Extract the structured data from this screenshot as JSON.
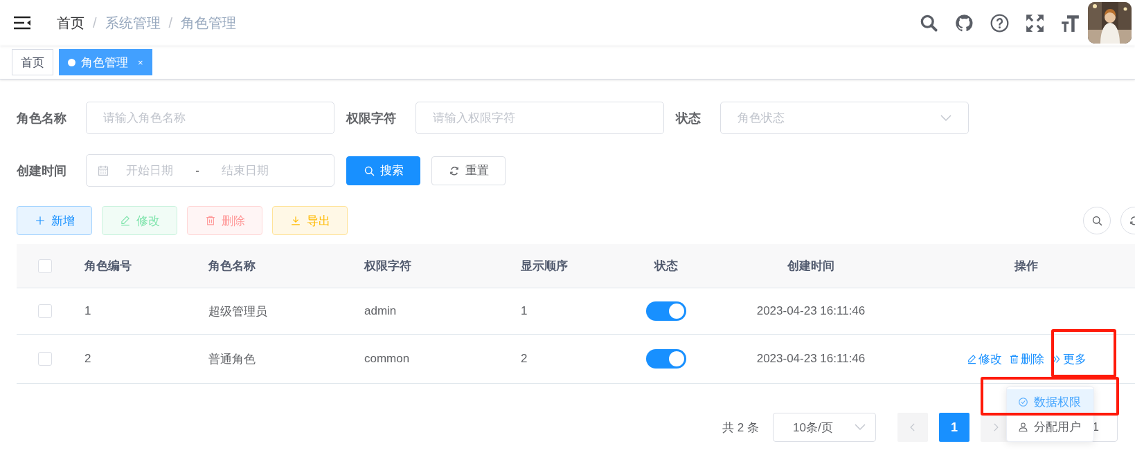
{
  "header": {
    "breadcrumb": [
      {
        "label": "首页",
        "kind": "link"
      },
      {
        "label": "系统管理",
        "kind": "text"
      },
      {
        "label": "角色管理",
        "kind": "text"
      }
    ],
    "separator": "/"
  },
  "tags": [
    {
      "label": "首页",
      "selected": false
    },
    {
      "label": "角色管理",
      "selected": true,
      "close": "×"
    }
  ],
  "search_form": {
    "fields": [
      {
        "kind": "input",
        "label": "角色名称",
        "placeholder": "请输入角色名称"
      },
      {
        "kind": "input",
        "label": "权限字符",
        "placeholder": "请输入权限字符"
      },
      {
        "kind": "select",
        "label": "状态",
        "placeholder": "角色状态"
      }
    ],
    "date_range": {
      "label": "创建时间",
      "start_placeholder": "开始日期",
      "separator": "-",
      "end_placeholder": "结束日期"
    },
    "buttons": [
      {
        "kind": "primary",
        "label": "搜索"
      },
      {
        "kind": "default",
        "label": "重置"
      }
    ]
  },
  "toolbar": [
    {
      "kind": "primary",
      "label": "新增",
      "disabled": false
    },
    {
      "kind": "success",
      "label": "修改",
      "disabled": true
    },
    {
      "kind": "danger",
      "label": "删除",
      "disabled": true
    },
    {
      "kind": "warning",
      "label": "导出",
      "disabled": false
    }
  ],
  "table": {
    "select_all_checked": false,
    "columns": [
      "角色编号",
      "角色名称",
      "权限字符",
      "显示顺序",
      "状态",
      "创建时间",
      "操作"
    ],
    "rows": [
      {
        "checked": false,
        "cells": [
          "1",
          "超级管理员",
          "admin",
          "1"
        ],
        "status_on": true,
        "created": "2023-04-23 16:11:46"
      },
      {
        "checked": false,
        "cells": [
          "2",
          "普通角色",
          "common",
          "2"
        ],
        "status_on": true,
        "created": "2023-04-23 16:11:46",
        "actions": [
          {
            "kind": "edit",
            "label": "修改"
          },
          {
            "kind": "delete",
            "label": "删除"
          },
          {
            "kind": "more",
            "label": "更多"
          }
        ]
      }
    ]
  },
  "pagination": {
    "total": "共 2 条",
    "page_size": "10条/页",
    "pages": [
      {
        "label": "1",
        "selected": true
      }
    ],
    "jumper_value": "1"
  },
  "dropdown": {
    "items": [
      {
        "kind": "data-scope",
        "label": "数据权限",
        "selected": true
      },
      {
        "kind": "assign-user",
        "label": "分配用户",
        "selected": false
      }
    ]
  }
}
